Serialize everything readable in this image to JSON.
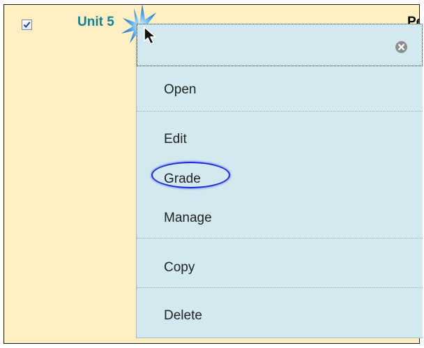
{
  "row": {
    "checkbox_checked": true,
    "item_title": "Unit 5",
    "column_header": "Pe"
  },
  "context_menu": {
    "items": [
      {
        "label": "Open"
      },
      {
        "label": "Edit"
      },
      {
        "label": "Grade",
        "highlighted": true
      },
      {
        "label": "Manage"
      },
      {
        "label": "Copy"
      },
      {
        "label": "Delete"
      }
    ]
  },
  "colors": {
    "row_background": "#fdefc3",
    "menu_background": "#d2e9f0",
    "link": "#1a7f8f",
    "highlight_ring": "#1d2bd6"
  },
  "icons": [
    "checkbox-checked-icon",
    "close-icon",
    "mouse-cursor-icon",
    "click-burst-icon"
  ]
}
